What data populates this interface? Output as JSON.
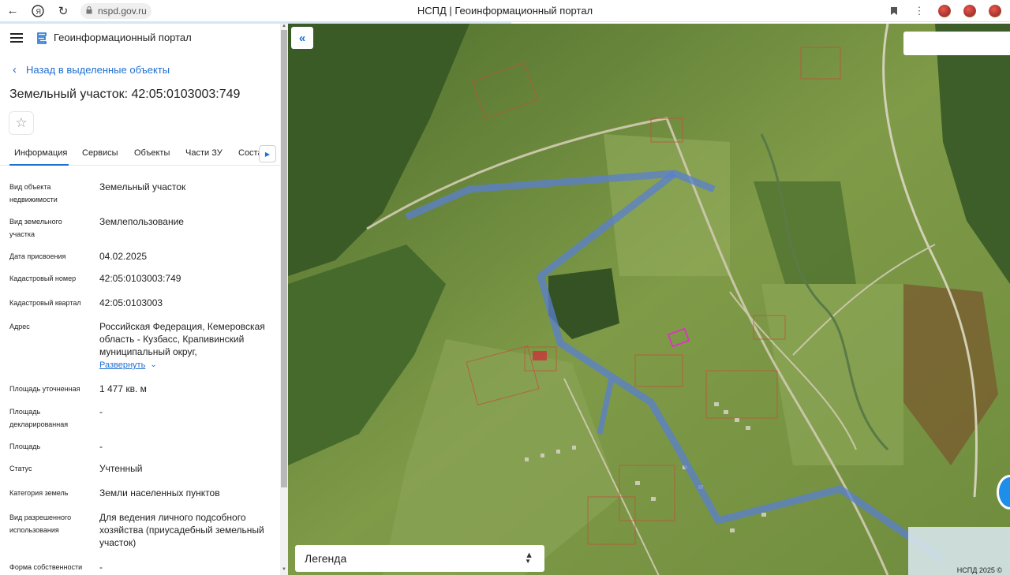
{
  "browser": {
    "url": "nspd.gov.ru",
    "tab_title": "НСПД | Геоинформационный портал"
  },
  "header": {
    "portal_name": "Геоинформационный портал"
  },
  "back_link": "Назад в выделенные объекты",
  "object_title": "Земельный участок: 42:05:0103003:749",
  "tabs": [
    {
      "label": "Информация",
      "active": true
    },
    {
      "label": "Сервисы",
      "active": false
    },
    {
      "label": "Объекты",
      "active": false
    },
    {
      "label": "Части ЗУ",
      "active": false
    },
    {
      "label": "Состав ЗУ",
      "active": false
    }
  ],
  "info": {
    "type_label": "Вид объекта недвижимости",
    "type_value": "Земельный участок",
    "plot_kind_label": "Вид земельного участка",
    "plot_kind_value": "Землепользование",
    "assigned_label": "Дата присвоения",
    "assigned_value": "04.02.2025",
    "cadnum_label": "Кадастровый номер",
    "cadnum_value": "42:05:0103003:749",
    "quarter_label": "Кадастровый квартал",
    "quarter_value": "42:05:0103003",
    "address_label": "Адрес",
    "address_value": "Российская Федерация, Кемеровская область - Кузбасс, Крапивинский муниципальный округ,",
    "address_expand": "Развернуть",
    "area_spec_label": "Площадь уточненная",
    "area_spec_value": "1 477 кв. м",
    "area_decl_label": "Площадь декларированная",
    "area_decl_value": "-",
    "area_label": "Площадь",
    "area_value": "-",
    "status_label": "Статус",
    "status_value": "Учтенный",
    "category_label": "Категория земель",
    "category_value": "Земли населенных пунктов",
    "permitted_label": "Вид разрешенного использования",
    "permitted_value": "Для ведения личного подсобного хозяйства (приусадебный земельный участок)",
    "ownership_label": "Форма собственности",
    "ownership_value": "-"
  },
  "map": {
    "legend_label": "Легенда",
    "copyright": "НСПД 2025 ©"
  },
  "colors": {
    "accent": "#1f6fd1",
    "route": "#5a7fd0",
    "selected_parcel": "#d43cb8"
  }
}
